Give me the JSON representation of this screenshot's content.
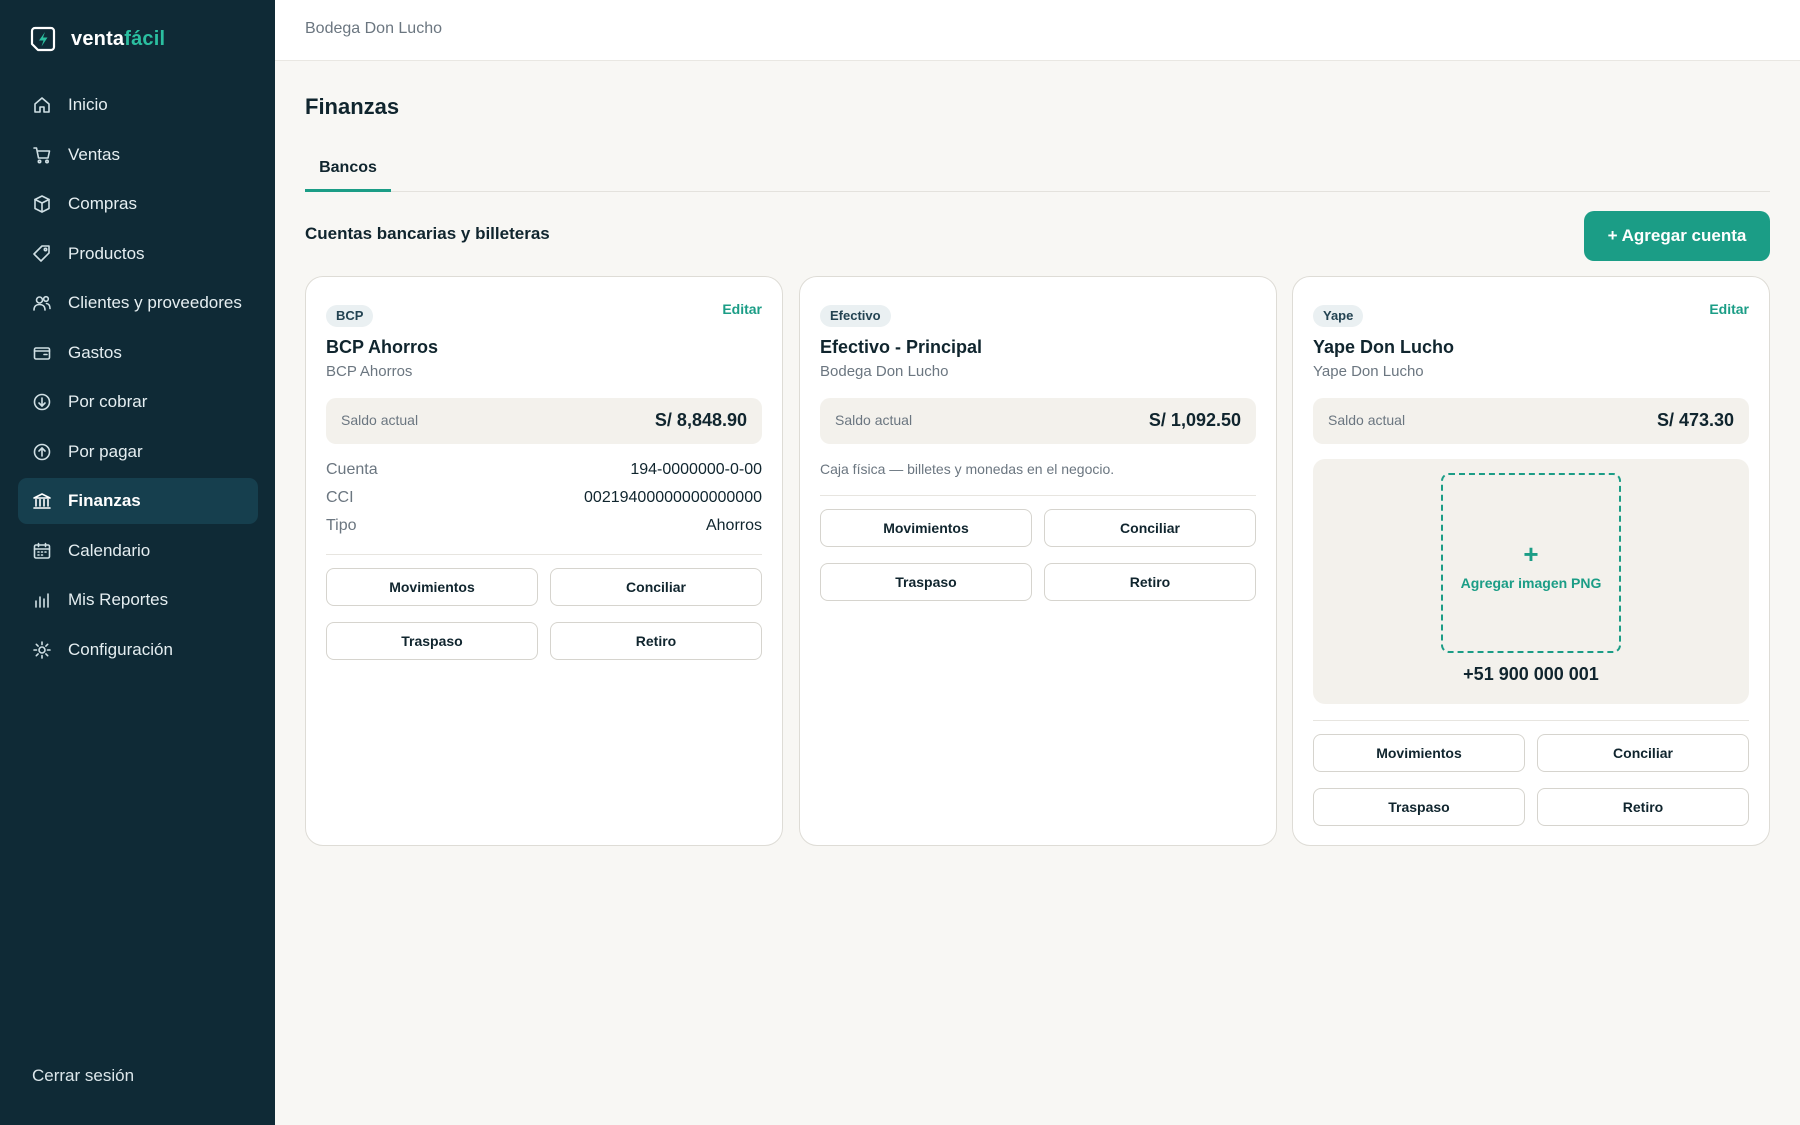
{
  "brand": {
    "name_main": "venta",
    "name_accent": "fácil",
    "icon": "bolt-logo-icon"
  },
  "colors": {
    "sidebar_bg": "#0f2a36",
    "sidebar_active": "#163f4e",
    "accent": "#1b9d86",
    "page_bg": "#f8f7f4"
  },
  "sidebar": {
    "items": [
      {
        "label": "Inicio",
        "icon": "home-icon"
      },
      {
        "label": "Ventas",
        "icon": "cart-icon"
      },
      {
        "label": "Compras",
        "icon": "box-icon"
      },
      {
        "label": "Productos",
        "icon": "tag-icon"
      },
      {
        "label": "Clientes y proveedores",
        "icon": "users-icon"
      },
      {
        "label": "Gastos",
        "icon": "wallet-icon"
      },
      {
        "label": "Por cobrar",
        "icon": "arrow-down-circle-icon"
      },
      {
        "label": "Por pagar",
        "icon": "arrow-up-circle-icon"
      },
      {
        "label": "Finanzas",
        "icon": "bank-icon",
        "active": true
      },
      {
        "label": "Calendario",
        "icon": "calendar-icon"
      },
      {
        "label": "Mis Reportes",
        "icon": "bar-chart-icon"
      },
      {
        "label": "Configuración",
        "icon": "gear-icon"
      }
    ],
    "logout_label": "Cerrar sesión"
  },
  "header": {
    "store_name": "Bodega Don Lucho"
  },
  "page": {
    "title": "Finanzas",
    "tabs": [
      {
        "label": "Bancos",
        "active": true
      }
    ],
    "section_title": "Cuentas bancarias y billeteras",
    "add_button_label": "+ Agregar cuenta"
  },
  "cards": [
    {
      "badge": "BCP",
      "edit_label": "Editar",
      "name": "BCP Ahorros",
      "subtitle": "BCP Ahorros",
      "balance_label": "Saldo actual",
      "balance_value": "S/ 8,848.90",
      "details": [
        {
          "label": "Cuenta",
          "value": "194-0000000-0-00"
        },
        {
          "label": "CCI",
          "value": "00219400000000000000"
        },
        {
          "label": "Tipo",
          "value": "Ahorros"
        }
      ],
      "actions": [
        "Movimientos",
        "Conciliar",
        "Traspaso",
        "Retiro"
      ]
    },
    {
      "badge": "Efectivo",
      "name": "Efectivo - Principal",
      "subtitle": "Bodega Don Lucho",
      "balance_label": "Saldo actual",
      "balance_value": "S/ 1,092.50",
      "description": "Caja física — billetes y monedas en el negocio.",
      "actions": [
        "Movimientos",
        "Conciliar",
        "Traspaso",
        "Retiro"
      ]
    },
    {
      "badge": "Yape",
      "edit_label": "Editar",
      "name": "Yape Don Lucho",
      "subtitle": "Yape Don Lucho",
      "balance_label": "Saldo actual",
      "balance_value": "S/ 473.30",
      "upload_plus": "+",
      "upload_label": "Agregar imagen PNG",
      "phone": "+51 900 000 001",
      "actions": [
        "Movimientos",
        "Conciliar",
        "Traspaso",
        "Retiro"
      ]
    }
  ]
}
